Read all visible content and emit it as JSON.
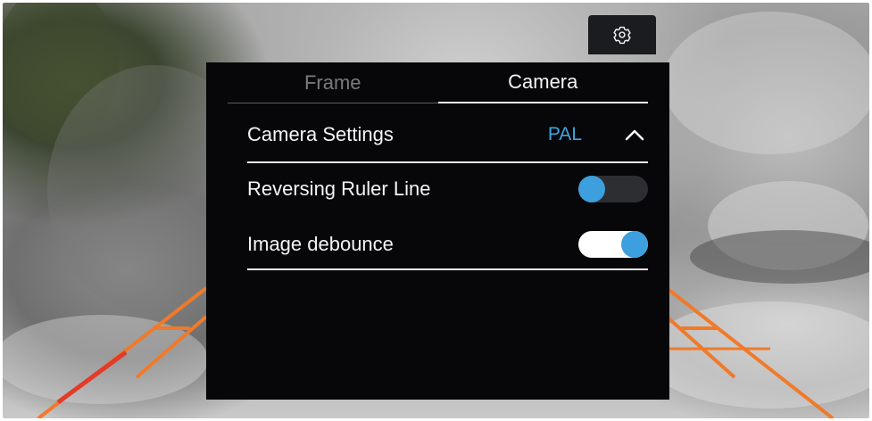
{
  "header": {
    "settings_icon": "gear-icon"
  },
  "tabs": [
    {
      "label": "Frame",
      "active": false
    },
    {
      "label": "Camera",
      "active": true
    }
  ],
  "camera_settings": {
    "label": "Camera Settings",
    "value": "PAL",
    "expand_icon": "chevron-up-icon"
  },
  "options": [
    {
      "label": "Reversing Ruler Line",
      "enabled": false
    },
    {
      "label": "Image debounce",
      "enabled": true
    }
  ],
  "colors": {
    "accent": "#3ea4e4",
    "panel_bg": "#07070a",
    "guide_line": "#f07a2a",
    "guide_line_danger": "#e23b2a"
  }
}
